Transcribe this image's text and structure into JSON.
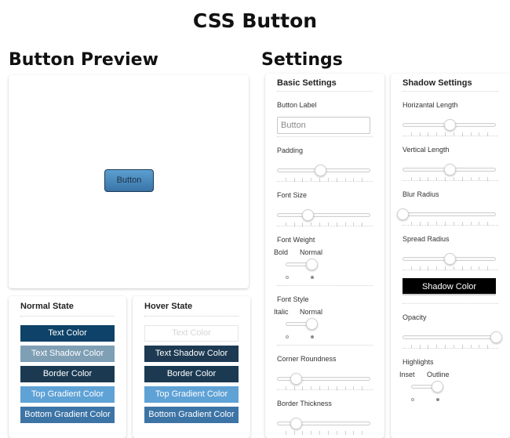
{
  "page": {
    "title": "CSS Button",
    "preview_heading": "Button Preview",
    "settings_heading": "Settings"
  },
  "preview": {
    "button_label": "Button"
  },
  "normal_state": {
    "title": "Normal State",
    "buttons": [
      {
        "label": "Text Color",
        "bg": "#0e4268",
        "fg": "#ffffff"
      },
      {
        "label": "Text Shadow Color",
        "bg": "#7f9fb5",
        "fg": "#ffffff"
      },
      {
        "label": "Border Color",
        "bg": "#1b3a52",
        "fg": "#ffffff"
      },
      {
        "label": "Top Gradient Color",
        "bg": "#5fa2d6",
        "fg": "#ffffff"
      },
      {
        "label": "Bottom Gradient Color",
        "bg": "#3d74a6",
        "fg": "#ffffff"
      }
    ]
  },
  "hover_state": {
    "title": "Hover State",
    "buttons": [
      {
        "label": "Text Color",
        "bg": "#ffffff",
        "fg": "#d6d6d6"
      },
      {
        "label": "Text Shadow Color",
        "bg": "#1d3a52",
        "fg": "#ffffff"
      },
      {
        "label": "Border Color",
        "bg": "#1b3a52",
        "fg": "#ffffff"
      },
      {
        "label": "Top Gradient Color",
        "bg": "#5fa2d6",
        "fg": "#ffffff"
      },
      {
        "label": "Bottom Gradient Color",
        "bg": "#3d74a6",
        "fg": "#ffffff"
      }
    ]
  },
  "basic_settings": {
    "title": "Basic Settings",
    "button_label": {
      "label": "Button Label",
      "placeholder": "Button"
    },
    "padding": {
      "label": "Padding",
      "value": 0.46
    },
    "font_size": {
      "label": "Font Size",
      "value": 0.33
    },
    "font_weight": {
      "label": "Font Weight",
      "left": "Bold",
      "right": "Normal",
      "value": 1
    },
    "font_style": {
      "label": "Font Style",
      "left": "Italic",
      "right": "Normal",
      "value": 1
    },
    "corner_roundness": {
      "label": "Corner Roundness",
      "value": 0.2
    },
    "border_thickness": {
      "label": "Border Thickness",
      "value": 0.2
    }
  },
  "shadow_settings": {
    "title": "Shadow Settings",
    "horizontal_length": {
      "label": "Horizantal Length",
      "value": 0.5
    },
    "vertical_length": {
      "label": "Vertical Length",
      "value": 0.5
    },
    "blur_radius": {
      "label": "Blur Radius",
      "value": 0.0
    },
    "spread_radius": {
      "label": "Spread Radius",
      "value": 0.5
    },
    "shadow_color": {
      "label": "Shadow Color",
      "bg": "#000000",
      "fg": "#ffffff"
    },
    "opacity": {
      "label": "Opacity",
      "value": 1.0
    },
    "highlights": {
      "label": "Highlights",
      "left": "Inset",
      "right": "Outline",
      "value": 1
    }
  }
}
